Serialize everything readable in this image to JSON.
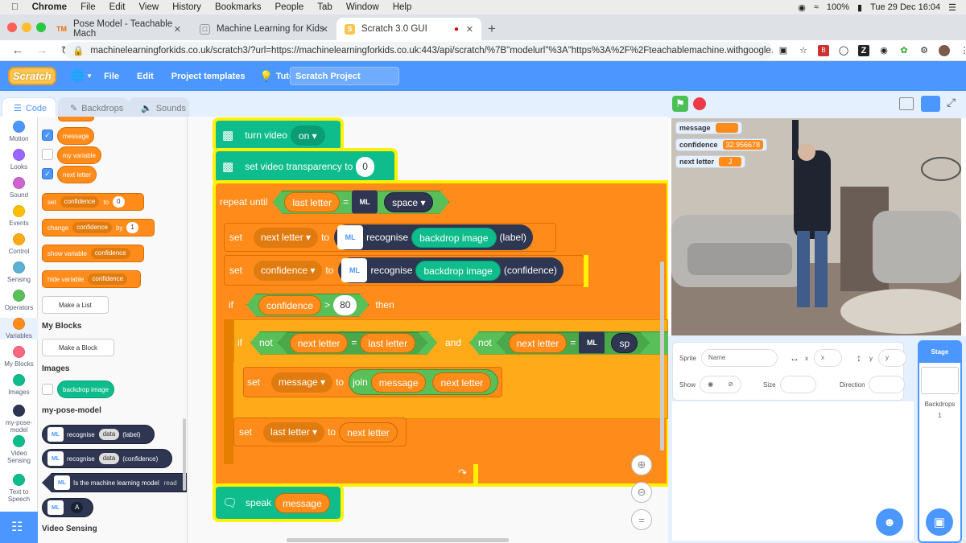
{
  "os_menubar": {
    "app": "Chrome",
    "items": [
      "File",
      "Edit",
      "View",
      "History",
      "Bookmarks",
      "People",
      "Tab",
      "Window",
      "Help"
    ],
    "battery": "100%",
    "datetime": "Tue 29 Dec  16:04"
  },
  "browser": {
    "tabs": [
      {
        "title": "Pose Model - Teachable Mach",
        "active": false
      },
      {
        "title": "Machine Learning for Kids",
        "active": false
      },
      {
        "title": "Scratch 3.0 GUI",
        "active": true
      }
    ],
    "url": "machinelearningforkids.co.uk/scratch3/?url=https://machinelearningforkids.co.uk:443/api/scratch/%7B\"modelurl\"%3A\"https%3A%2F%2Fteachablemachine.withgoogle..."
  },
  "scratch_menu": {
    "logo": "Scratch",
    "file": "File",
    "edit": "Edit",
    "templates": "Project templates",
    "tutorials": "Tutorials",
    "project_name": "Scratch Project"
  },
  "editor_tabs": {
    "code": "Code",
    "backdrops": "Backdrops",
    "sounds": "Sounds"
  },
  "categories": [
    {
      "label": "Motion",
      "color": "#4c97ff"
    },
    {
      "label": "Looks",
      "color": "#9966ff"
    },
    {
      "label": "Sound",
      "color": "#cf63cf"
    },
    {
      "label": "Events",
      "color": "#ffbf00"
    },
    {
      "label": "Control",
      "color": "#ffab19"
    },
    {
      "label": "Sensing",
      "color": "#5cb1d6"
    },
    {
      "label": "Operators",
      "color": "#59c059"
    },
    {
      "label": "Variables",
      "color": "#ff8c1a"
    },
    {
      "label": "My Blocks",
      "color": "#ff6680"
    },
    {
      "label": "Images",
      "color": "#0fbd8c"
    },
    {
      "label": "my-pose-model",
      "color": "#2e3651"
    },
    {
      "label": "Video Sensing",
      "color": "#0fbd8c"
    },
    {
      "label": "Text to Speech",
      "color": "#0fbd8c"
    }
  ],
  "palette": {
    "vars": [
      "message",
      "my variable",
      "next letter"
    ],
    "set": "set",
    "set_var": "confidence",
    "to": "to",
    "set_val": "0",
    "change": "change",
    "change_var": "confidence",
    "by": "by",
    "change_val": "1",
    "show": "show variable",
    "show_var": "confidence",
    "hide": "hide variable",
    "hide_var": "confidence",
    "make_list": "Make a List",
    "my_blocks": "My Blocks",
    "make_block": "Make a Block",
    "images": "Images",
    "backdrop_image": "backdrop image",
    "pose_model": "my-pose-model",
    "recognise": "recognise",
    "data": "data",
    "label": "(label)",
    "confidence": "(confidence)",
    "ready": "Is the machine learning model",
    "ready_tail": "read",
    "letter_a": "A",
    "video_sensing": "Video Sensing"
  },
  "script": {
    "turn_video": "turn video",
    "on": "on",
    "transparency": "set video transparency to",
    "transparency_val": "0",
    "repeat_until": "repeat until",
    "last_letter": "last letter",
    "eq": "=",
    "space": "space",
    "set": "set",
    "next_letter": "next letter",
    "to": "to",
    "recognise": "recognise",
    "backdrop_image": "backdrop image",
    "label": "(label)",
    "confidence": "confidence",
    "confidence_paren": "(confidence)",
    "if": "if",
    "gt": ">",
    "eighty": "80",
    "then": "then",
    "not": "not",
    "and": "and",
    "sp": "sp",
    "message": "message",
    "join": "join",
    "speak": "speak"
  },
  "monitors": [
    {
      "label": "message",
      "value": ""
    },
    {
      "label": "confidence",
      "value": "32.956678"
    },
    {
      "label": "next letter",
      "value": "J"
    }
  ],
  "sprite_info": {
    "sprite": "Sprite",
    "name_placeholder": "Name",
    "x": "x",
    "y": "y",
    "show": "Show",
    "size": "Size",
    "direction": "Direction"
  },
  "stage_panel": {
    "stage": "Stage",
    "backdrops": "Backdrops",
    "count": "1"
  }
}
